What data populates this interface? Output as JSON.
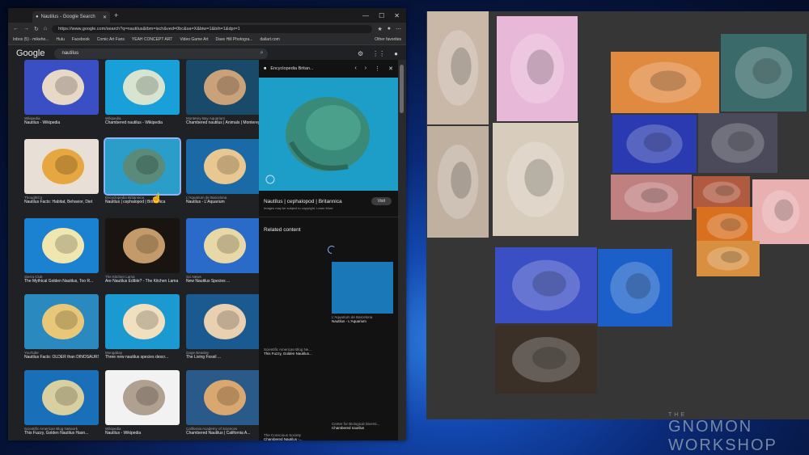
{
  "browser": {
    "tab_title": "Nautilus - Google Search",
    "url": "https://www.google.com/search?q=nautilus&tbm=isch&ved=0bc&sa=X&biw=1&bih=1&dpr=1",
    "bookmarks": [
      "Inbox (5) - mikeho...",
      "Hulu",
      "Facebook",
      "Comic Art Fans",
      "YEAH CONCEPT ART",
      "Video Game Art",
      "Dave Hill Photogra...",
      "dailart.com"
    ],
    "other_favorites": "Other favorites",
    "google_logo": "Google",
    "search_query": "nautilus"
  },
  "results": [
    {
      "source": "Wikipedia",
      "title": "Nautilus - Wikipedia",
      "bg": "#3a4fc4",
      "fg": "#e8d8c8"
    },
    {
      "source": "Wikipedia",
      "title": "Chambered nautilus - Wikipedia",
      "bg": "#1aa0d8",
      "fg": "#d8e4d0"
    },
    {
      "source": "Monterey Bay Aquarium",
      "title": "Chambered nautilus | Animals | Monterey...",
      "bg": "#1a4a6a",
      "fg": "#c9a27a"
    },
    {
      "source": "ThoughtCo",
      "title": "Nautilus Facts: Habitat, Behavior, Diet",
      "bg": "#e8e0d6",
      "fg": "#e6a640"
    },
    {
      "source": "Encyclopedia Britannica",
      "title": "Nautilus | cephalopod | Britannica",
      "bg": "#2a9ec8",
      "fg": "#5a8a7a"
    },
    {
      "source": "L'Aquarium de Barcelona",
      "title": "Nautilus - L'Aquarium",
      "bg": "#1a6aa8",
      "fg": "#e8c890"
    },
    {
      "source": "Sierra Club",
      "title": "The Mythical Golden Nautilus, Too R...",
      "bg": "#1a82d0",
      "fg": "#f0e6b0"
    },
    {
      "source": "The Kitchen Lama",
      "title": "Are Nautilus Edible? - The Kitchen Lama",
      "bg": "#1a1410",
      "fg": "#c49a6a"
    },
    {
      "source": "Sci.News",
      "title": "New Nautilus Species ...",
      "bg": "#2a6ac8",
      "fg": "#e8d8a8"
    },
    {
      "source": "YouTube",
      "title": "Nautilus Facts: OLDER than DINOSAURS ...",
      "bg": "#2a8ac0",
      "fg": "#e8c878"
    },
    {
      "source": "Mongabay",
      "title": "Three new nautilus species descr...",
      "bg": "#1a9ad0",
      "fg": "#f0e0c0"
    },
    {
      "source": "Gage Beasley",
      "title": "The Living Fossil ...",
      "bg": "#1a5a90",
      "fg": "#e8d0b0"
    },
    {
      "source": "Scientific American Blog Network",
      "title": "This Fuzzy, Golden Nautilus Hasn...",
      "bg": "#1a70b8",
      "fg": "#d8d0a0"
    },
    {
      "source": "Wikipedia",
      "title": "Nautilus - Wikipedia",
      "bg": "#f2f2f2",
      "fg": "#b0a090"
    },
    {
      "source": "California Academy of Sciences",
      "title": "Chambered Nautilus | California A...",
      "bg": "#2a5a8a",
      "fg": "#d8a870"
    }
  ],
  "panel": {
    "site": "Encyclopedia Britan...",
    "title": "Nautilus | cephalopod | Britannica",
    "visit": "Visit",
    "note": "Images may be subject to copyright. Learn More",
    "learn_more": "Learn More",
    "related_heading": "Related content",
    "related": [
      {
        "source": "NOAA Fisheries",
        "title": "Chambered Nautilus |...",
        "bg": "#121212"
      },
      {
        "source": "Wikipedia",
        "title": "Chambered nautilus -...",
        "bg": "#121212"
      },
      {
        "source": "Scientific American Blog Ne...",
        "title": "This Fuzzy, Golden Nautilus...",
        "bg": "#121212"
      },
      {
        "source": "L'Aquarium de Barcelona",
        "title": "Nautilus - L'Aquarium",
        "bg": "#1a78b8"
      },
      {
        "source": "The Conscious Society",
        "title": "Chambered Nautilus -...",
        "bg": "#121212"
      },
      {
        "source": "Center for Biological Diversi...",
        "title": "Chambered nautilus",
        "bg": "#121212"
      }
    ]
  },
  "refboard": [
    {
      "name": "sketch-diving-suit",
      "bg": "#c9b8a8"
    },
    {
      "name": "robot-illustration",
      "bg": "#e8b8d8"
    },
    {
      "name": "sketch-nautilus-figures",
      "bg": "#c0b0a0"
    },
    {
      "name": "sketch-nautilus-studies",
      "bg": "#d8ccbc"
    },
    {
      "name": "octopus-orange",
      "bg": "#e08a40"
    },
    {
      "name": "octopus-teal",
      "bg": "#3a6a6a"
    },
    {
      "name": "octopus-blue-bg",
      "bg": "#2a3ab0"
    },
    {
      "name": "octopus-red-dark",
      "bg": "#4a4a5a"
    },
    {
      "name": "octopus-pink",
      "bg": "#c08080"
    },
    {
      "name": "octopus-closeup",
      "bg": "#b05a40"
    },
    {
      "name": "octopus-eye-orange",
      "bg": "#d87020"
    },
    {
      "name": "octopus-pink-tentacles",
      "bg": "#e8b0b0"
    },
    {
      "name": "octopus-eye-closeup",
      "bg": "#d89040"
    },
    {
      "name": "nautilus-blue-1",
      "bg": "#3a4fc4"
    },
    {
      "name": "nautilus-blue-2",
      "bg": "#1a60c8"
    },
    {
      "name": "nautilus-dark",
      "bg": "#3a3028"
    }
  ],
  "watermark": {
    "line1": "THE",
    "line2": "GNOMON",
    "line3": "WORKSHOP"
  }
}
